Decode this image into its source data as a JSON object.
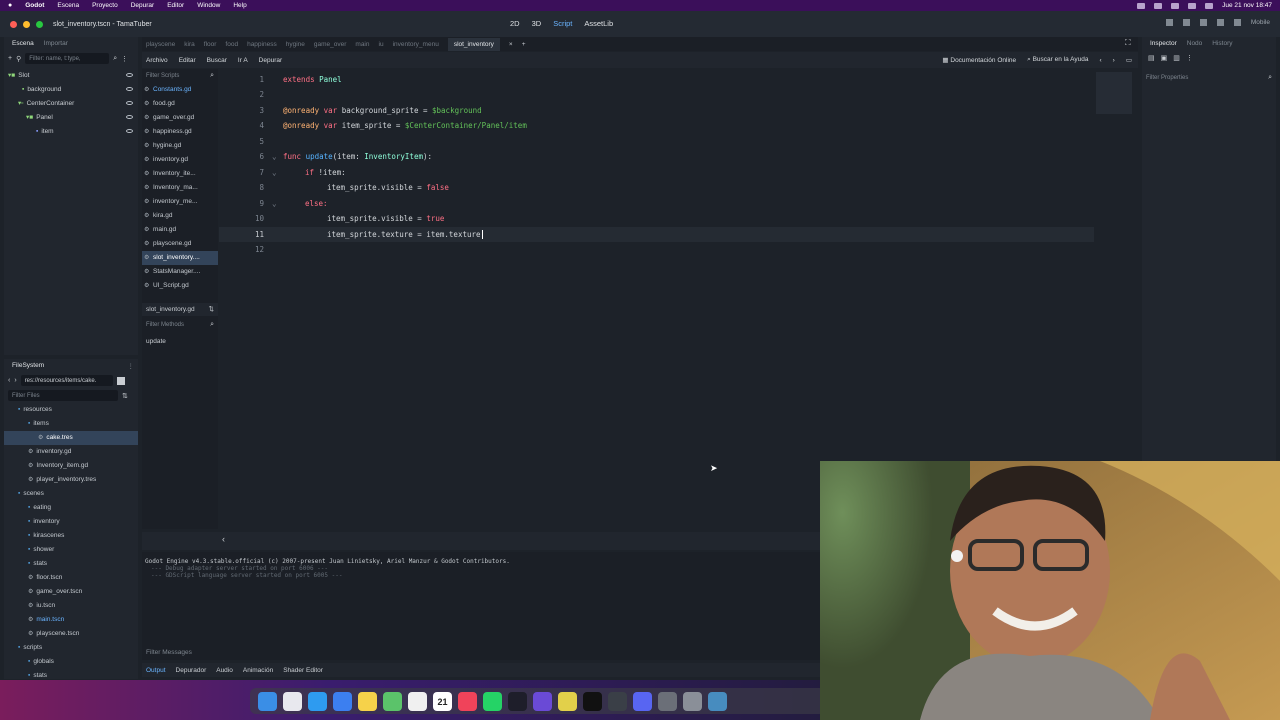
{
  "menubar": {
    "apple": "",
    "items": [
      "Godot",
      "Escena",
      "Proyecto",
      "Depurar",
      "Editor",
      "Window",
      "Help"
    ],
    "datetime": "Jue 21 nov 18:47"
  },
  "window": {
    "title": "slot_inventory.tscn - TamaTuber",
    "modes": [
      "2D",
      "3D",
      "Script",
      "AssetLib"
    ],
    "active_mode": "Script",
    "device": "Mobile"
  },
  "scene_dock": {
    "tabs": [
      "Escena",
      "Importar"
    ],
    "filter_placeholder": "Filter: name, t:type,",
    "tree": [
      {
        "label": "Slot",
        "depth": 0
      },
      {
        "label": "background",
        "depth": 1
      },
      {
        "label": "CenterContainer",
        "depth": 1
      },
      {
        "label": "Panel",
        "depth": 2
      },
      {
        "label": "item",
        "depth": 3
      }
    ]
  },
  "filesystem": {
    "title": "FileSystem",
    "path": "res://resources/items/cake.",
    "filter_placeholder": "Filter Files",
    "entries": [
      {
        "label": "resources",
        "kind": "folder",
        "depth": 1
      },
      {
        "label": "items",
        "kind": "folder",
        "depth": 2
      },
      {
        "label": "cake.tres",
        "kind": "file",
        "depth": 3,
        "selected": true
      },
      {
        "label": "inventory.gd",
        "kind": "file",
        "depth": 2
      },
      {
        "label": "Inventory_item.gd",
        "kind": "file",
        "depth": 2
      },
      {
        "label": "player_inventory.tres",
        "kind": "file",
        "depth": 2
      },
      {
        "label": "scenes",
        "kind": "folder",
        "depth": 1
      },
      {
        "label": "eating",
        "kind": "folder",
        "depth": 2
      },
      {
        "label": "inventory",
        "kind": "folder",
        "depth": 2
      },
      {
        "label": "kirascenes",
        "kind": "folder",
        "depth": 2
      },
      {
        "label": "shower",
        "kind": "folder",
        "depth": 2
      },
      {
        "label": "stats",
        "kind": "folder",
        "depth": 2
      },
      {
        "label": "floor.tscn",
        "kind": "file",
        "depth": 2
      },
      {
        "label": "game_over.tscn",
        "kind": "file",
        "depth": 2
      },
      {
        "label": "iu.tscn",
        "kind": "file",
        "depth": 2
      },
      {
        "label": "main.tscn",
        "kind": "file",
        "depth": 2,
        "blue": true
      },
      {
        "label": "playscene.tscn",
        "kind": "file",
        "depth": 2
      },
      {
        "label": "scripts",
        "kind": "folder",
        "depth": 1
      },
      {
        "label": "globals",
        "kind": "folder",
        "depth": 2
      },
      {
        "label": "stats",
        "kind": "folder",
        "depth": 2
      }
    ]
  },
  "scene_tabs": [
    "playscene",
    "kira",
    "floor",
    "food",
    "happiness",
    "hygine",
    "game_over",
    "main",
    "iu",
    "inventory_menu",
    "slot_inventory"
  ],
  "script_menu": [
    "Archivo",
    "Editar",
    "Buscar",
    "Ir A",
    "Depurar"
  ],
  "script_links": {
    "docs": "Documentación Online",
    "help": "Buscar en la Ayuda"
  },
  "scripts_panel": {
    "filter_placeholder": "Filter Scripts",
    "files": [
      "Constants.gd",
      "food.gd",
      "game_over.gd",
      "happiness.gd",
      "hygine.gd",
      "inventory.gd",
      "Inventory_ite...",
      "Inventory_ma...",
      "inventory_me...",
      "kira.gd",
      "main.gd",
      "playscene.gd",
      "slot_inventory....",
      "StatsManager....",
      "UI_Script.gd"
    ],
    "selected": "slot_inventory....",
    "current_file": "slot_inventory.gd",
    "methods_placeholder": "Filter Methods",
    "methods": [
      "update"
    ]
  },
  "code": {
    "line_numbers": [
      "1",
      "2",
      "3",
      "4",
      "5",
      "6",
      "7",
      "8",
      "9",
      "10",
      "11",
      "12"
    ],
    "l1": {
      "kw": "extends",
      "ty": "Panel"
    },
    "l3": {
      "an": "@onready",
      "kw": "var",
      "name": "background_sprite =",
      "nd": "$background"
    },
    "l4": {
      "an": "@onready",
      "kw": "var",
      "name": "item_sprite =",
      "nd": "$CenterContainer/Panel/item"
    },
    "l6": {
      "kw": "func",
      "fn": "update",
      "args": "(item: ",
      "ty": "InventoryItem",
      "end": "):"
    },
    "l7": {
      "kw": "if",
      "rest": "!item:"
    },
    "l8": {
      "rest": "item_sprite.visible = ",
      "bo": "false"
    },
    "l9": {
      "kw": "else:"
    },
    "l10": {
      "rest": "item_sprite.visible = ",
      "bo": "true"
    },
    "l11": {
      "rest": "item_sprite.texture = item.texture"
    }
  },
  "inspector": {
    "tabs": [
      "Inspector",
      "Nodo",
      "History"
    ],
    "filter_placeholder": "Filter Properties"
  },
  "output": {
    "lines": [
      "Godot Engine v4.3.stable.official (c) 2007-present Juan Linietsky, Ariel Manzur & Godot Contributors.",
      "--- Debug adapter server started on port 6006 ---",
      "--- GDScript language server started on port 6005 ---"
    ],
    "filter_placeholder": "Filter Messages",
    "bottom_tabs": [
      "Output",
      "Depurador",
      "Audio",
      "Animación",
      "Shader Editor"
    ]
  },
  "dock": {
    "calendar_day": "21"
  },
  "colors": {
    "accent": "#6ab4ff",
    "menubar": "#3b0f5a"
  }
}
